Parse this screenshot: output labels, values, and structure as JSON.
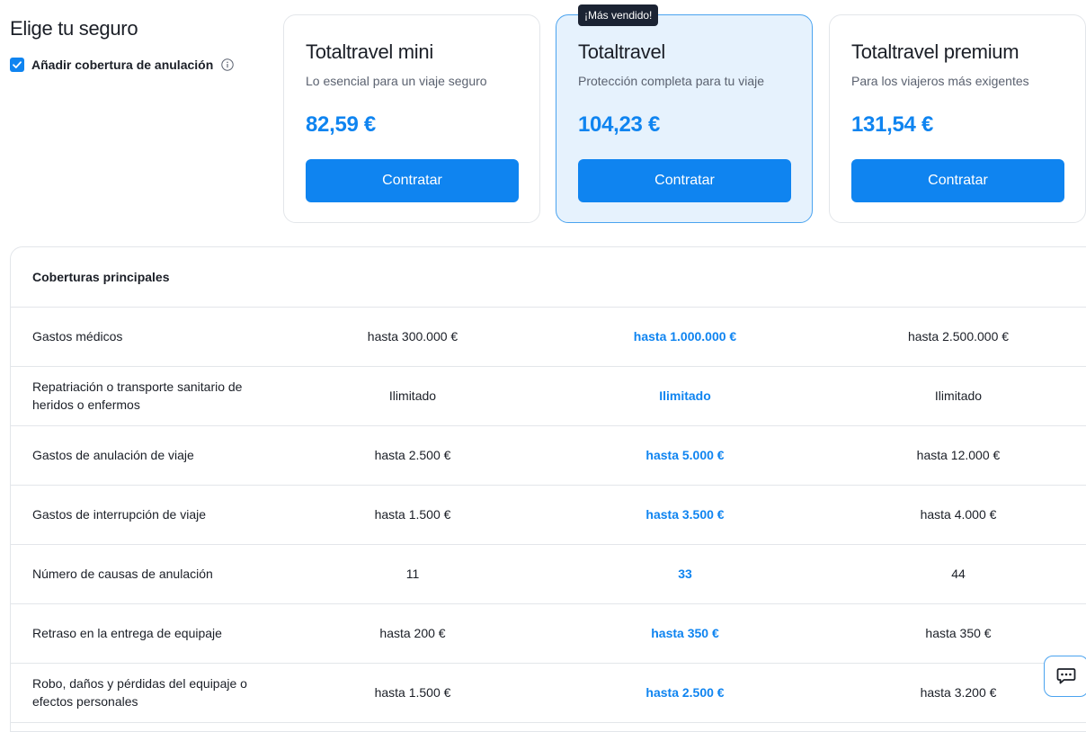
{
  "page": {
    "title": "Elige tu seguro",
    "cancellation_option_label": "Añadir cobertura de anulación",
    "cancellation_checked": true
  },
  "plans": [
    {
      "name": "Totaltravel mini",
      "description": "Lo esencial para un viaje seguro",
      "price": "82,59 €",
      "button_label": "Contratar"
    },
    {
      "name": "Totaltravel",
      "description": "Protección completa para tu viaje",
      "price": "104,23 €",
      "button_label": "Contratar",
      "badge": "¡Más vendido!"
    },
    {
      "name": "Totaltravel premium",
      "description": "Para los viajeros más exigentes",
      "price": "131,54 €",
      "button_label": "Contratar"
    }
  ],
  "coverage": {
    "header": "Coberturas principales",
    "rows": [
      {
        "label": "Gastos médicos",
        "values": [
          "hasta 300.000 €",
          "hasta 1.000.000 €",
          "hasta 2.500.000 €"
        ]
      },
      {
        "label": "Repatriación o transporte sanitario de heridos o enfermos",
        "values": [
          "Ilimitado",
          "Ilimitado",
          "Ilimitado"
        ]
      },
      {
        "label": "Gastos de anulación de viaje",
        "values": [
          "hasta 2.500 €",
          "hasta 5.000 €",
          "hasta 12.000 €"
        ]
      },
      {
        "label": "Gastos de interrupción de viaje",
        "values": [
          "hasta 1.500 €",
          "hasta 3.500 €",
          "hasta 4.000 €"
        ]
      },
      {
        "label": "Número de causas de anulación",
        "values": [
          "11",
          "33",
          "44"
        ]
      },
      {
        "label": "Retraso en la entrega de equipaje",
        "values": [
          "hasta 200 €",
          "hasta 350 €",
          "hasta 350 €"
        ]
      },
      {
        "label": "Robo, daños y pérdidas del equipaje o efectos personales",
        "values": [
          "hasta 1.500 €",
          "hasta 2.500 €",
          "hasta 3.200 €"
        ]
      }
    ]
  },
  "icons": {
    "checkbox": "check-icon",
    "info": "info-icon",
    "chat": "chat-icon"
  },
  "colors": {
    "accent": "#0f84f0",
    "highlight_bg": "#e6f2fd",
    "badge_bg": "#1b2333"
  }
}
